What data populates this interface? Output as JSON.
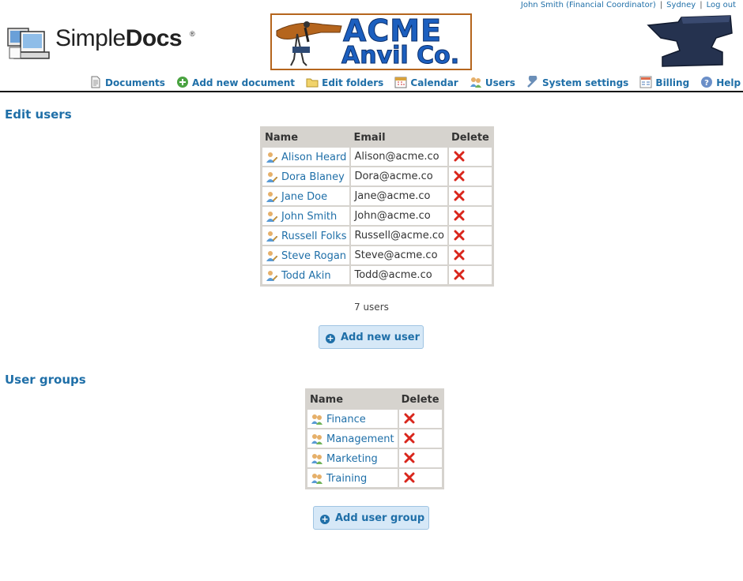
{
  "userbar": {
    "user": "John Smith (Financial Coordinator)",
    "location": "Sydney",
    "logout": "Log out"
  },
  "brand": {
    "simple": "Simple",
    "docs": "Docs",
    "reg": "®",
    "company_line1": "ACME",
    "company_line2": "Anvil Co."
  },
  "nav": {
    "items": [
      {
        "label": "Documents",
        "icon": "document-icon"
      },
      {
        "label": "Add new document",
        "icon": "add-icon"
      },
      {
        "label": "Edit folders",
        "icon": "folder-icon"
      },
      {
        "label": "Calendar",
        "icon": "calendar-icon"
      },
      {
        "label": "Users",
        "icon": "users-icon"
      },
      {
        "label": "System settings",
        "icon": "wrench-icon"
      },
      {
        "label": "Billing",
        "icon": "billing-icon"
      },
      {
        "label": "Help",
        "icon": "help-icon"
      }
    ]
  },
  "users": {
    "title": "Edit users",
    "headers": {
      "name": "Name",
      "email": "Email",
      "delete": "Delete"
    },
    "rows": [
      {
        "name": "Alison Heard",
        "email": "Alison@acme.co"
      },
      {
        "name": "Dora Blaney",
        "email": "Dora@acme.co"
      },
      {
        "name": "Jane Doe",
        "email": "Jane@acme.co"
      },
      {
        "name": "John Smith",
        "email": "John@acme.co"
      },
      {
        "name": "Russell Folks",
        "email": "Russell@acme.co"
      },
      {
        "name": "Steve Rogan",
        "email": "Steve@acme.co"
      },
      {
        "name": "Todd Akin",
        "email": "Todd@acme.co"
      }
    ],
    "count": "7 users",
    "add_button": "Add new user"
  },
  "groups": {
    "title": "User groups",
    "headers": {
      "name": "Name",
      "delete": "Delete"
    },
    "rows": [
      {
        "name": "Finance"
      },
      {
        "name": "Management"
      },
      {
        "name": "Marketing"
      },
      {
        "name": "Training"
      }
    ],
    "add_button": "Add user group"
  },
  "colors": {
    "link": "#1f6fa8",
    "header_bg": "#d6d3ce",
    "button_bg": "#d6e8f7",
    "delete_red": "#d9261c"
  }
}
